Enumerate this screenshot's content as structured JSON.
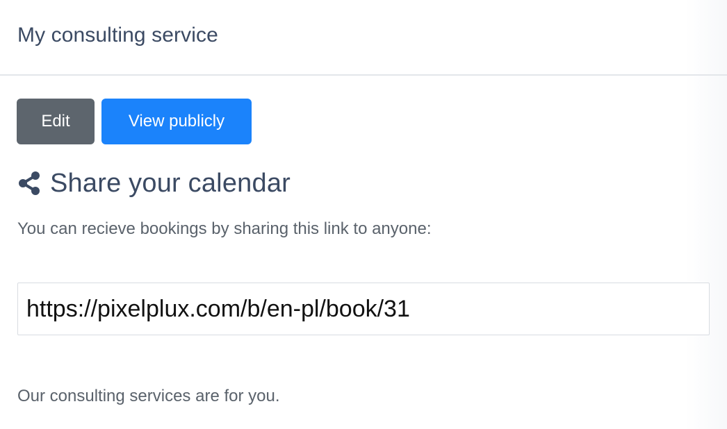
{
  "header": {
    "title": "My consulting service"
  },
  "actions": {
    "edit_label": "Edit",
    "view_label": "View publicly"
  },
  "share": {
    "icon": "share-icon",
    "title": "Share your calendar",
    "description": "You can recieve bookings by sharing this link to anyone:",
    "link": "https://pixelplux.com/b/en-pl/book/31"
  },
  "footer": {
    "text": "Our consulting services are for you."
  },
  "colors": {
    "heading": "#3b4a63",
    "edit_button": "#5d656d",
    "view_button": "#1b83fb",
    "body_text": "#5a626b"
  }
}
